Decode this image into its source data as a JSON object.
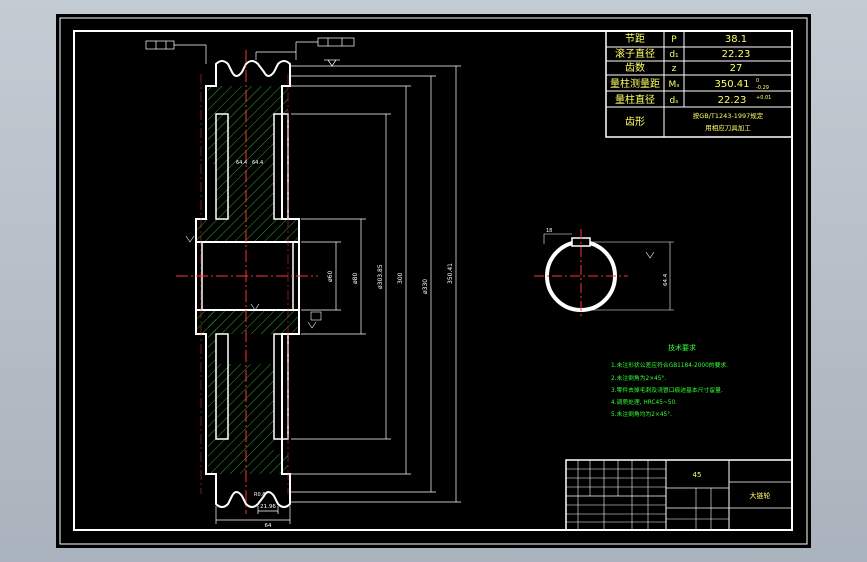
{
  "drawing": {
    "param_table": [
      {
        "name": "节距",
        "symbol": "P",
        "value": "38.1"
      },
      {
        "name": "滚子直径",
        "symbol": "d₁",
        "value": "22.23"
      },
      {
        "name": "齿数",
        "symbol": "z",
        "value": "27"
      },
      {
        "name": "量柱测量距",
        "symbol": "Mₛ",
        "value": "350.41"
      },
      {
        "name": "量柱直径",
        "symbol": "dₛ",
        "value": "22.23"
      }
    ],
    "tooth_form": {
      "label": "齿形",
      "line1": "按GB/T1243-1997规定",
      "line2": "用相应刀具加工"
    },
    "tech_req": {
      "title": "技术要求",
      "items": [
        "1.未注形状公差应符合GB1184-2000的要求.",
        "2.未注倒角为2×45°.",
        "3.零件去掉毛刺及浇冒口痕迹基本尺寸留量.",
        "4.调质处理, HRC45~50.",
        "5.未注倒角均为2×45°."
      ]
    },
    "title_block": {
      "material": "45",
      "part_name": "大链轮"
    },
    "dims": {
      "d1": "350.41",
      "d2": "300",
      "d3": "ø330",
      "d4": "ø303.85",
      "d5": "ø80",
      "d6": "ø60",
      "tooth_w": "21.96",
      "hub_w": "64",
      "key_w": "18",
      "bore_depth": "64.4"
    }
  }
}
